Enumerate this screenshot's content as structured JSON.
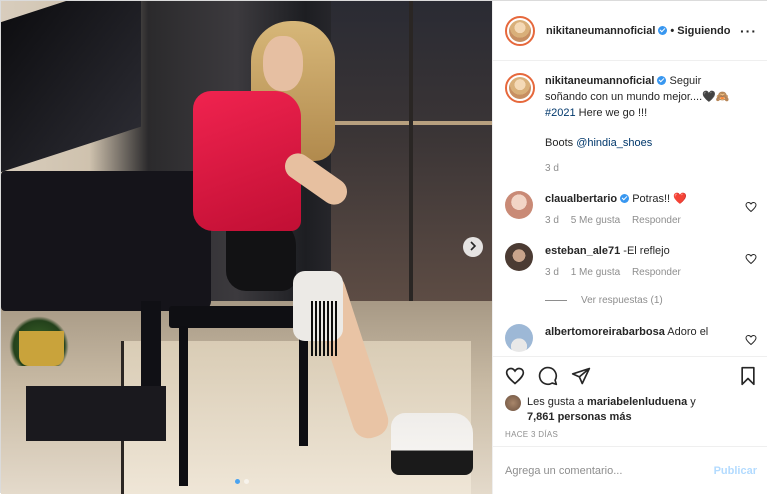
{
  "post_header": {
    "username": "nikitaneumannoficial",
    "separator": "•",
    "follow_label": "Siguiendo",
    "more_icon": "more-horizontal-icon"
  },
  "caption": {
    "username": "nikitaneumannoficial",
    "text": "Seguir soñando con un mundo mejor....",
    "emojis": "🖤🙈",
    "hashtag": "#2021",
    "text2": "Here we go !!!",
    "boots_prefix": "Boots",
    "boots_mention": "@hindia_shoes",
    "age": "3 d"
  },
  "comments": [
    {
      "username": "claualbertario",
      "verified": true,
      "text": "Potras!!",
      "emoji": "❤️",
      "age": "3 d",
      "likes": "5 Me gusta",
      "reply": "Responder"
    },
    {
      "username": "esteban_ale71",
      "verified": false,
      "text": "-El reflejo",
      "age": "3 d",
      "likes": "1 Me gusta",
      "reply": "Responder",
      "view_replies": "Ver respuestas (1)"
    },
    {
      "username": "albertomoreirabarbosa",
      "text": "Adoro el"
    }
  ],
  "likes": {
    "prefix": "Les gusta a",
    "user": "mariabelenluduena",
    "joiner": "y",
    "count": "7,861 personas más"
  },
  "timestamp": "HACE 3 DÍAS",
  "add_comment": {
    "placeholder": "Agrega un comentario...",
    "publish_label": "Publicar"
  },
  "colors": {
    "accent": "#3897f0",
    "heart": "#ed4956",
    "publish_disabled": "#b3dbff"
  }
}
